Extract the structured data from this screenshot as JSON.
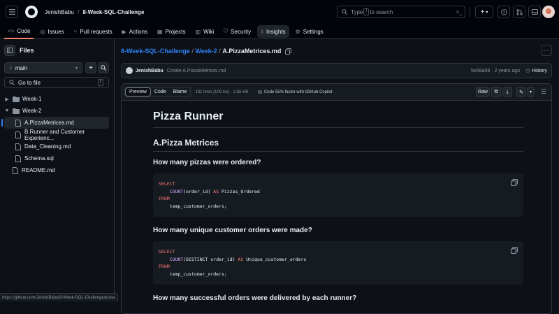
{
  "header": {
    "owner": "JenishBabu",
    "separator": "/",
    "repo": "8-Week-SQL-Challenge",
    "search_prefix": "Type",
    "search_key": "/",
    "search_suffix": "to search",
    "plus_label": "+",
    "tabs": [
      {
        "label": "Code",
        "icon": "code-icon"
      },
      {
        "label": "Issues",
        "icon": "issue-icon"
      },
      {
        "label": "Pull requests",
        "icon": "pull-request-icon"
      },
      {
        "label": "Actions",
        "icon": "actions-icon"
      },
      {
        "label": "Projects",
        "icon": "projects-icon"
      },
      {
        "label": "Wiki",
        "icon": "wiki-icon"
      },
      {
        "label": "Security",
        "icon": "shield-icon"
      },
      {
        "label": "Insights",
        "icon": "graph-icon"
      },
      {
        "label": "Settings",
        "icon": "gear-icon"
      }
    ]
  },
  "sidebar": {
    "title": "Files",
    "branch": "main",
    "goto_placeholder": "Go to file",
    "goto_key": "t",
    "tree": [
      {
        "name": "Week-1",
        "type": "folder",
        "level": 0,
        "expanded": false
      },
      {
        "name": "Week-2",
        "type": "folder",
        "level": 0,
        "expanded": true
      },
      {
        "name": "A.PizzaMetrices.md",
        "type": "file",
        "level": 1,
        "selected": true
      },
      {
        "name": "B.Runner and Customer Experienc...",
        "type": "file",
        "level": 1
      },
      {
        "name": "Data_Cleaning.md",
        "type": "file",
        "level": 1
      },
      {
        "name": "Schema.sql",
        "type": "file",
        "level": 1
      },
      {
        "name": "README.md",
        "type": "file",
        "level": 0
      }
    ]
  },
  "breadcrumb": {
    "repo": "8-Week-SQL-Challenge",
    "sep1": "/",
    "folder": "Week-2",
    "sep2": "/",
    "file": "A.PizzaMetrices.md"
  },
  "commit": {
    "author": "JenishBabu",
    "message": "Create A.PizzaMetrices.md",
    "hash_time": "5e58a08 · 2 years ago",
    "history_label": "History"
  },
  "file_toolbar": {
    "preview": "Preview",
    "code": "Code",
    "blame": "Blame",
    "meta": "131 lines (109 loc) · 2.65 KB",
    "copilot": "Code 55% faster with GitHub Copilot",
    "raw": "Raw"
  },
  "doc": {
    "h1": "Pizza Runner",
    "h2": "A.Pizza Metrices",
    "q1": "How many pizzas were ordered?",
    "q2": "How many unique customer orders were made?",
    "q3": "How many successful orders were delivered by each runner?",
    "code1": {
      "l1": "SELECT",
      "l2_indent": "    ",
      "l2_fn": "COUNT",
      "l2_mid": "(order_id) ",
      "l2_as": "AS",
      "l2_end": " Pizzas_Ordered",
      "l3": "FROM",
      "l4": "    temp_customer_orders;"
    },
    "code2": {
      "l1": "SELECT",
      "l2_indent": "    ",
      "l2_fn": "COUNT",
      "l2_mid": "(DISTINCT order_id) ",
      "l2_as": "AS",
      "l2_end": " Unique_customer_orders",
      "l3": "FROM",
      "l4": "    temp_customer_orders;"
    }
  },
  "status_url": "https://github.com/JenishBabu/8-Week-SQL-Challenge/pulse",
  "colors": {
    "accent": "#2f81f7",
    "tab_underline": "#f78166",
    "keyword": "#ff7b72",
    "function": "#d2a8ff"
  }
}
